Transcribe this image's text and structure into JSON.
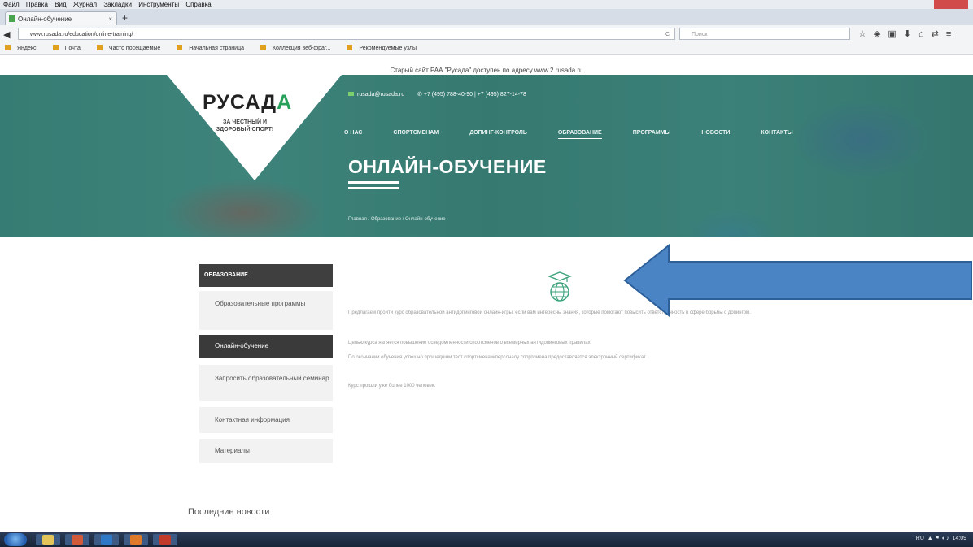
{
  "browser": {
    "menu": [
      "Файл",
      "Правка",
      "Вид",
      "Журнал",
      "Закладки",
      "Инструменты",
      "Справка"
    ],
    "tab_title": "Онлайн-обучение",
    "tab_close": "×",
    "new_tab": "+",
    "url": "www.rusada.ru/education/online-training/",
    "url_reload": "C",
    "search_placeholder": "Поиск",
    "bookmarks": [
      "Яндекс",
      "Почта",
      "Часто посещаемые",
      "Начальная страница",
      "Коллекция веб-фраг...",
      "Рекомендуемые узлы"
    ]
  },
  "site": {
    "notice": "Старый сайт РАА \"Русада\" доступен по адресу www.2.rusada.ru",
    "logo": {
      "main": "РУСАД",
      "accent": "А",
      "tagline": "ЗА ЧЕСТНЫЙ И ЗДОРОВЫЙ СПОРТ!"
    },
    "contacts": {
      "email": "rusada@rusada.ru",
      "phones": "+7 (495) 788-40-90  |  +7 (495) 827-14-78"
    },
    "nav": [
      "О НАС",
      "СПОРТСМЕНАМ",
      "ДОПИНГ-КОНТРОЛЬ",
      "ОБРАЗОВАНИЕ",
      "ПРОГРАММЫ",
      "НОВОСТИ",
      "КОНТАКТЫ"
    ],
    "nav_active_index": 3,
    "page_title": "ОНЛАЙН-ОБУЧЕНИЕ",
    "breadcrumb": "Главная / Образование / Онлайн-обучение"
  },
  "sidebar": {
    "heading": "ОБРАЗОВАНИЕ",
    "items": [
      "Образовательные программы",
      "Онлайн-обучение",
      "Запросить образовательный семинар",
      "Контактная информация",
      "Материалы"
    ],
    "active_index": 1
  },
  "content": {
    "paragraphs": [
      "Предлагаем пройти курс образовательной антидопинговой онлайн-игры, если вам интересны знания, которые помогают повысить ответственность в сфере борьбы с допингом.",
      "Целью курса является повышение осведомленности спортсменов о всемирных антидопинговых правилах.",
      "По окончании обучения успешно прошедшим тест спортсменам/персоналу спортсмена предоставляется электронный сертификат.",
      "Курс прошли уже более 1000 человек."
    ],
    "news_heading": "Последние новости"
  },
  "annotation": {
    "arrow_color": "#4a84c4"
  },
  "taskbar": {
    "lang": "RU",
    "time": "14:09"
  }
}
